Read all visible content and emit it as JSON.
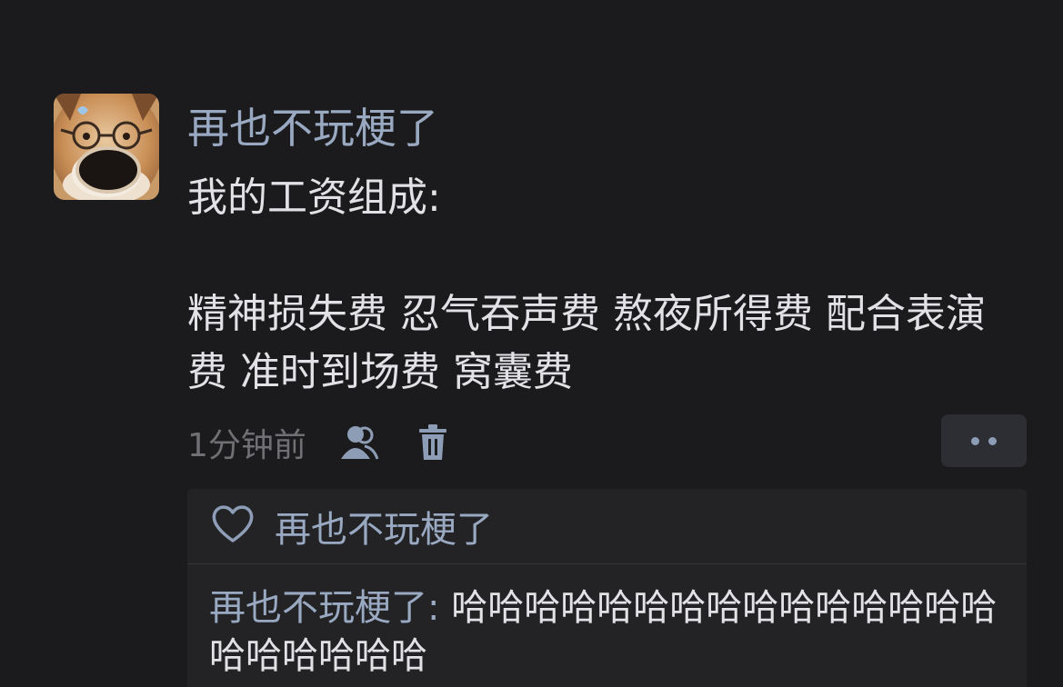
{
  "post": {
    "author": "再也不玩梗了",
    "text_lines": [
      "我的工资组成:",
      "",
      "精神损失费 忍气吞声费 熬夜所得费 配合表演费 准时到场费 窝囊费"
    ],
    "time": "1分钟前"
  },
  "actions": {
    "visibility_icon": "friends-icon",
    "delete_icon": "trash-icon",
    "more_icon": "more-dots-icon"
  },
  "interactions": {
    "like_icon": "heart-icon",
    "likes": "再也不玩梗了",
    "comments": [
      {
        "name": "再也不玩梗了",
        "separator": ": ",
        "text": "哈哈哈哈哈哈哈哈哈哈哈哈哈哈哈哈哈哈哈哈哈"
      }
    ]
  },
  "colors": {
    "background": "#1b1b1d",
    "name": "#9aa9c2",
    "text": "#e2e2e6",
    "muted": "#6f6f74",
    "panel": "#232326"
  }
}
